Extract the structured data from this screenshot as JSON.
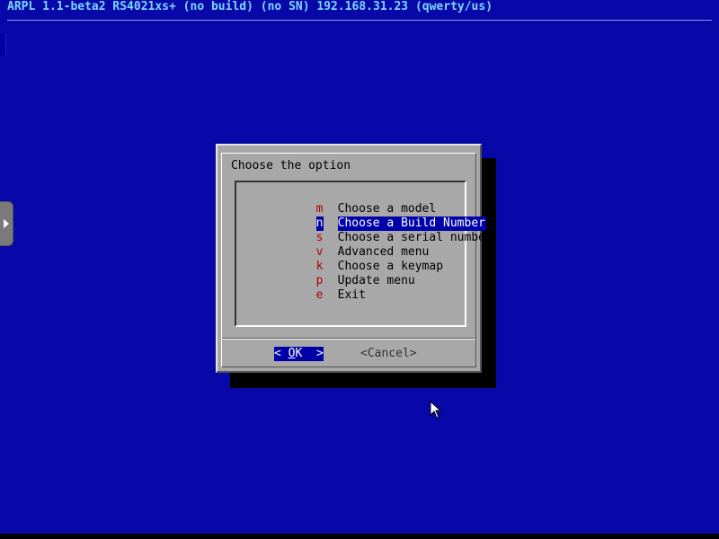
{
  "window": {
    "title": "ARPL 1.1-beta2 RS4021xs+ (no build) (no SN) 192.168.31.23 (qwerty/us)"
  },
  "dialog": {
    "prompt": "Choose the option",
    "items": [
      {
        "key": "m",
        "label": "Choose a model",
        "selected": false
      },
      {
        "key": "n",
        "label": "Choose a Build Number",
        "selected": true
      },
      {
        "key": "s",
        "label": "Choose a serial number",
        "selected": false
      },
      {
        "key": "v",
        "label": "Advanced menu",
        "selected": false
      },
      {
        "key": "k",
        "label": "Choose a keymap",
        "selected": false
      },
      {
        "key": "p",
        "label": "Update menu",
        "selected": false
      },
      {
        "key": "e",
        "label": "Exit",
        "selected": false
      }
    ],
    "ok_left": "< ",
    "ok_hot": "O",
    "ok_rest": "K  >",
    "cancel_label": "<Cancel>"
  },
  "colors": {
    "background": "#0808a8",
    "title_text": "#7ad7ff",
    "dialog_bg": "#a8a8a8",
    "highlight": "#0000a8",
    "hotkey": "#b00000"
  },
  "icons": {
    "side_tab": "chevron-right-icon",
    "pointer": "mouse-cursor-icon"
  }
}
